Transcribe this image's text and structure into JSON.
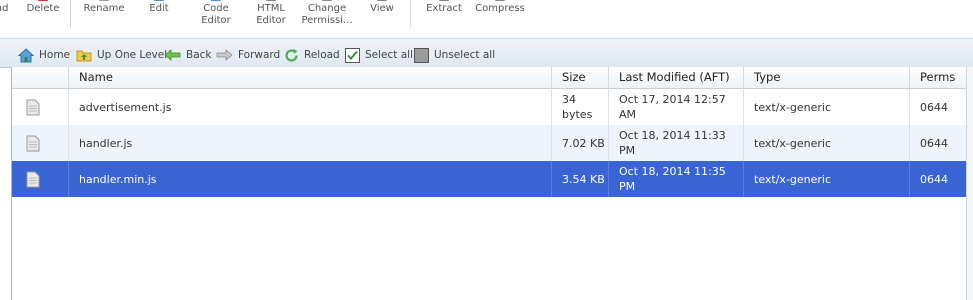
{
  "toolbar": {
    "buttons": [
      {
        "label": "ad",
        "icon": "upload-icon"
      },
      {
        "label": "Delete",
        "icon": "delete-icon"
      },
      {
        "label": "Rename",
        "icon": "rename-icon"
      },
      {
        "label": "Edit",
        "icon": "edit-icon"
      },
      {
        "label": "Code\nEditor",
        "icon": "code-editor-icon"
      },
      {
        "label": "HTML\nEditor",
        "icon": "html-editor-icon"
      },
      {
        "label": "Change\nPermissi...",
        "icon": "permissions-icon"
      },
      {
        "label": "View",
        "icon": "view-icon"
      },
      {
        "label": "Extract",
        "icon": "extract-icon"
      },
      {
        "label": "Compress",
        "icon": "compress-icon"
      }
    ]
  },
  "nav": {
    "home": "Home",
    "up_one_level": "Up One Level",
    "back": "Back",
    "forward": "Forward",
    "reload": "Reload",
    "select_all": "Select all",
    "unselect_all": "Unselect all"
  },
  "table": {
    "columns": [
      "Name",
      "Size",
      "Last Modified (AFT)",
      "Type",
      "Perms"
    ],
    "rows": [
      {
        "name": "advertisement.js",
        "size": "34 bytes",
        "modified": "Oct 17, 2014 12:57\nAM",
        "type": "text/x-generic",
        "perms": "0644",
        "selected": false
      },
      {
        "name": "handler.js",
        "size": "7.02 KB",
        "modified": "Oct 18, 2014 11:33\nPM",
        "type": "text/x-generic",
        "perms": "0644",
        "selected": false
      },
      {
        "name": "handler.min.js",
        "size": "3.54 KB",
        "modified": "Oct 18, 2014 11:35\nPM",
        "type": "text/x-generic",
        "perms": "0644",
        "selected": true
      }
    ]
  },
  "colors": {
    "selected_row": "#3a64d4",
    "alt_row": "#eef4fb",
    "navbar": "#e4ecf4"
  }
}
